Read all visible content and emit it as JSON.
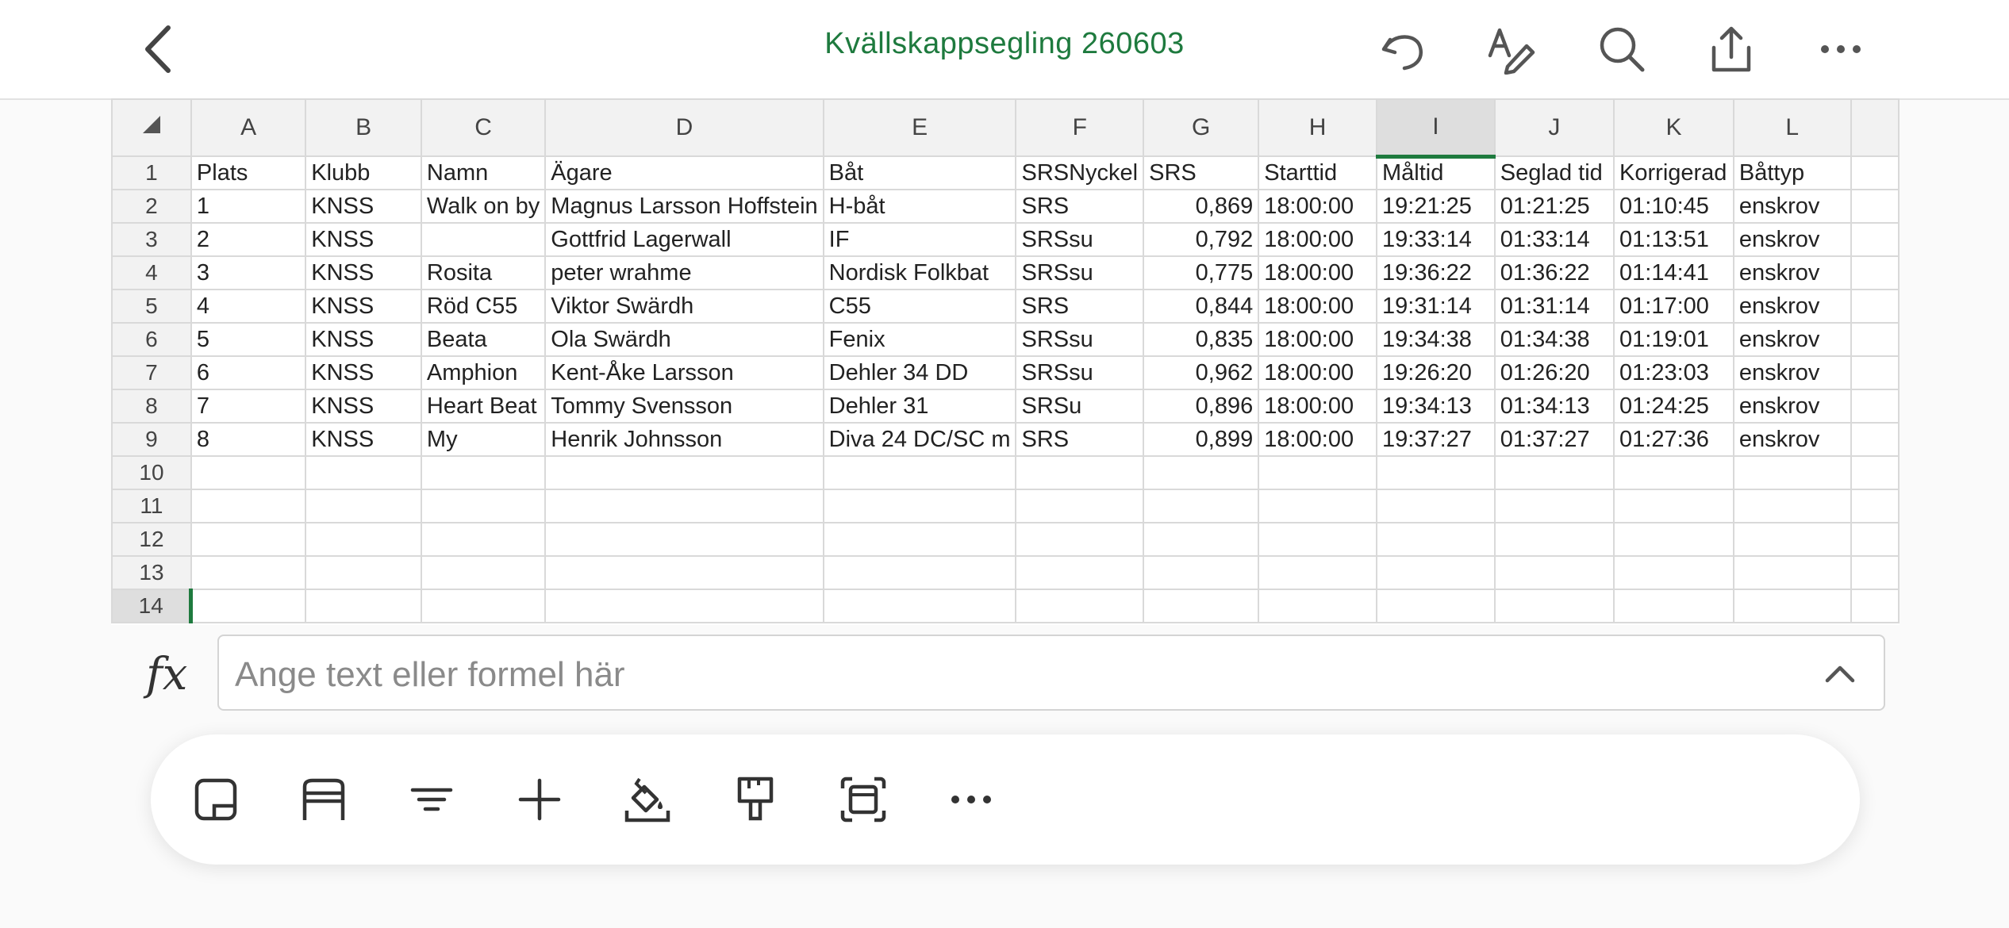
{
  "header": {
    "title": "Kvällskappsegling 260603",
    "back_icon": "chevron-left-icon",
    "icons": [
      "undo-icon",
      "draw-icon",
      "search-icon",
      "share-icon",
      "more-icon"
    ],
    "accent_color": "#1e7a3e"
  },
  "sheet": {
    "columns": [
      "A",
      "B",
      "C",
      "D",
      "E",
      "F",
      "G",
      "H",
      "I",
      "J",
      "K",
      "L"
    ],
    "selected_column": "I",
    "selected_row": "14",
    "row_numbers": [
      "1",
      "2",
      "3",
      "4",
      "5",
      "6",
      "7",
      "8",
      "9",
      "10",
      "11",
      "12",
      "13",
      "14"
    ],
    "rows": [
      [
        "Plats",
        "Klubb",
        "Namn",
        "Ägare",
        "Båt",
        "SRSNyckel",
        "SRS",
        "Starttid",
        "Måltid",
        "Seglad tid",
        "Korrigerad",
        "Båttyp"
      ],
      [
        "1",
        "KNSS",
        "Walk on by",
        "Magnus Larsson Hoffstein",
        "H-båt",
        "SRS",
        "0,869",
        "18:00:00",
        "19:21:25",
        "01:21:25",
        "01:10:45",
        "enskrov"
      ],
      [
        "2",
        "KNSS",
        "",
        "Gottfrid Lagerwall",
        "IF",
        "SRSsu",
        "0,792",
        "18:00:00",
        "19:33:14",
        "01:33:14",
        "01:13:51",
        "enskrov"
      ],
      [
        "3",
        "KNSS",
        "Rosita",
        "peter wrahme",
        "Nordisk Folkbat",
        "SRSsu",
        "0,775",
        "18:00:00",
        "19:36:22",
        "01:36:22",
        "01:14:41",
        "enskrov"
      ],
      [
        "4",
        "KNSS",
        "Röd C55",
        "Viktor Swärdh",
        "C55",
        "SRS",
        "0,844",
        "18:00:00",
        "19:31:14",
        "01:31:14",
        "01:17:00",
        "enskrov"
      ],
      [
        "5",
        "KNSS",
        "Beata",
        "Ola Swärdh",
        "Fenix",
        "SRSsu",
        "0,835",
        "18:00:00",
        "19:34:38",
        "01:34:38",
        "01:19:01",
        "enskrov"
      ],
      [
        "6",
        "KNSS",
        "Amphion",
        "Kent-Åke Larsson",
        "Dehler 34 DD",
        "SRSsu",
        "0,962",
        "18:00:00",
        "19:26:20",
        "01:26:20",
        "01:23:03",
        "enskrov"
      ],
      [
        "7",
        "KNSS",
        "Heart Beat",
        "Tommy Svensson",
        "Dehler 31",
        "SRSu",
        "0,896",
        "18:00:00",
        "19:34:13",
        "01:34:13",
        "01:24:25",
        "enskrov"
      ],
      [
        "8",
        "KNSS",
        "My",
        "Henrik Johnsson",
        "Diva 24 DC/SC m",
        "SRS",
        "0,899",
        "18:00:00",
        "19:37:27",
        "01:37:27",
        "01:27:36",
        "enskrov"
      ],
      [
        "",
        "",
        "",
        "",
        "",
        "",
        "",
        "",
        "",
        "",
        "",
        ""
      ],
      [
        "",
        "",
        "",
        "",
        "",
        "",
        "",
        "",
        "",
        "",
        "",
        ""
      ],
      [
        "",
        "",
        "",
        "",
        "",
        "",
        "",
        "",
        "",
        "",
        "",
        ""
      ],
      [
        "",
        "",
        "",
        "",
        "",
        "",
        "",
        "",
        "",
        "",
        "",
        ""
      ],
      [
        "",
        "",
        "",
        "",
        "",
        "",
        "",
        "",
        "",
        "",
        "",
        ""
      ]
    ]
  },
  "formula_bar": {
    "label": "fx",
    "placeholder": "Ange text eller formel här"
  },
  "toolbar": {
    "icons": [
      "cell-format-icon",
      "row-format-icon",
      "filter-icon",
      "insert-icon",
      "fill-color-icon",
      "format-painter-icon",
      "select-range-icon",
      "more-options-icon"
    ]
  }
}
